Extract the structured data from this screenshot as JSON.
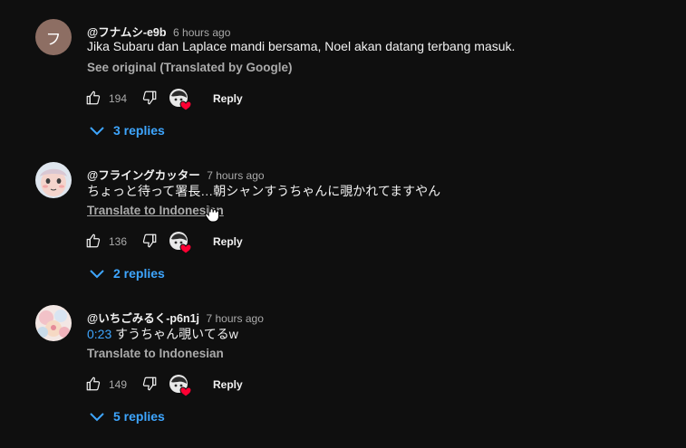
{
  "comments": [
    {
      "author": "@フナムシ-e9b",
      "time": "6 hours ago",
      "avatar_letter": "フ",
      "timestamp": "",
      "text": "Jika Subaru dan Laplace mandi bersama, Noel akan datang terbang masuk.",
      "translate_label": "See original (Translated by Google)",
      "likes": "194",
      "reply_label": "Reply",
      "replies_label": "3 replies"
    },
    {
      "author": "@フライングカッター",
      "time": "7 hours ago",
      "avatar_letter": "",
      "timestamp": "",
      "text": "ちょっと待って署長…朝シャンすうちゃんに覗かれてますやん",
      "translate_label": "Translate to Indonesian",
      "likes": "136",
      "reply_label": "Reply",
      "replies_label": "2 replies"
    },
    {
      "author": "@いちごみるく-p6n1j",
      "time": "7 hours ago",
      "avatar_letter": "",
      "timestamp": "0:23",
      "text": " すうちゃん覗いてるw",
      "translate_label": "Translate to Indonesian",
      "likes": "149",
      "reply_label": "Reply",
      "replies_label": "5 replies"
    }
  ],
  "colors": {
    "background": "#0f0f0f",
    "text": "#f1f1f1",
    "secondary_text": "#aaaaaa",
    "link": "#3ea6ff",
    "heart": "#ff0033"
  },
  "icons": [
    "like-icon",
    "dislike-icon",
    "creator-heart-icon",
    "chevron-down-icon",
    "hand-cursor-icon"
  ]
}
